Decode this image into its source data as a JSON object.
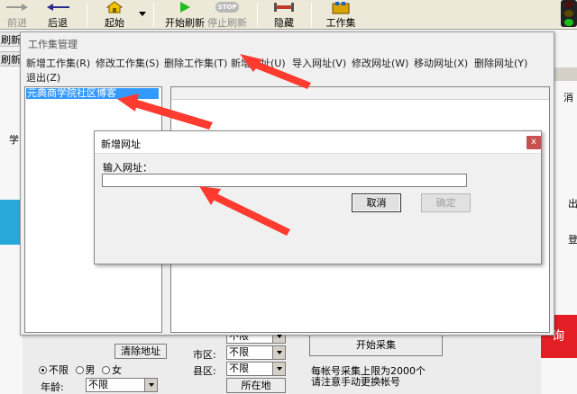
{
  "toolbar": {
    "back": "前进",
    "forward": "后退",
    "home": "起始",
    "start_refresh": "开始刷新",
    "stop_refresh": "停止刷新",
    "hide": "隐藏",
    "workset": "工作集",
    "stop_icon_text": "STOP"
  },
  "background": {
    "tab_left_1": "刷新",
    "tab_left_2": "刷新步",
    "side_char_1": "学",
    "right_char_1": "消",
    "right_char_2": "出",
    "right_char_3": "登",
    "clear_address": "清除地址",
    "gender_any": "不限",
    "gender_male": "男",
    "gender_female": "女",
    "age_label": "年龄:",
    "age_value": "不限",
    "city_label": "市区:",
    "city_value": "不限",
    "county_label": "县区:",
    "county_value": "不限",
    "location_button": "所在地",
    "start_collect": "开始采集",
    "collect_note_1": "每帐号采集上限为2000个",
    "collect_note_2": "请注意手动更换帐号",
    "red_button": "询",
    "province_value": "不限"
  },
  "manager": {
    "title": "工作集管理",
    "menu": [
      "新增工作集(R)",
      "修改工作集(S)",
      "删除工作集(T)",
      "新增网址(U)",
      "导入网址(V)",
      "修改网址(W)",
      "移动网址(X)",
      "删除网址(Y)",
      "退出(Z)"
    ],
    "selected_workset": "元典商学院社区博客"
  },
  "dialog": {
    "title": "新增网址",
    "close": "x",
    "label": "输入网址：",
    "input_value": "",
    "cancel": "取消",
    "ok": "确定"
  },
  "colors": {
    "accent": "#3399ff",
    "arrow": "#ff3b30",
    "close": "#c75050"
  }
}
